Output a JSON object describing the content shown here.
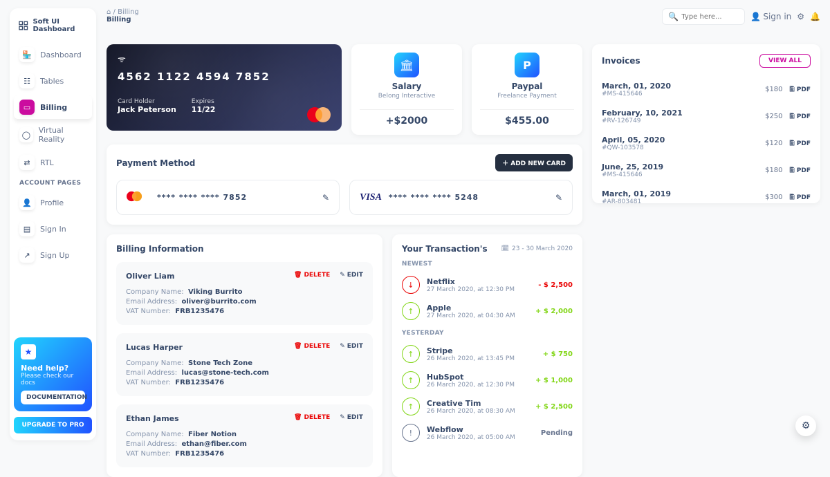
{
  "brand": "Soft UI Dashboard",
  "breadcrumb": {
    "root_icon": "home",
    "current": "Billing",
    "title": "Billing"
  },
  "search": {
    "placeholder": "Type here..."
  },
  "topnav": {
    "signin": "Sign in"
  },
  "sidebar": {
    "items": [
      {
        "icon": "store",
        "label": "Dashboard"
      },
      {
        "icon": "table",
        "label": "Tables"
      },
      {
        "icon": "card",
        "label": "Billing"
      },
      {
        "icon": "vr",
        "label": "Virtual Reality"
      },
      {
        "icon": "rtl",
        "label": "RTL"
      }
    ],
    "account_heading": "ACCOUNT PAGES",
    "account": [
      {
        "icon": "user",
        "label": "Profile"
      },
      {
        "icon": "doc",
        "label": "Sign In"
      },
      {
        "icon": "rocket",
        "label": "Sign Up"
      }
    ],
    "help": {
      "title": "Need help?",
      "sub": "Please check our docs",
      "btn": "DOCUMENTATION"
    },
    "upgrade": "UPGRADE TO PRO"
  },
  "credit_card": {
    "number": "4562   1122   4594   7852",
    "holder_label": "Card Holder",
    "holder": "Jack Peterson",
    "expires_label": "Expires",
    "expires": "11/22"
  },
  "mini": [
    {
      "icon": "bank",
      "title": "Salary",
      "sub": "Belong Interactive",
      "amount": "+$2000"
    },
    {
      "icon": "paypal",
      "title": "Paypal",
      "sub": "Freelance Payment",
      "amount": "$455.00"
    }
  ],
  "payment_method": {
    "title": "Payment Method",
    "add": "ADD NEW CARD",
    "cards": [
      {
        "brand": "mastercard",
        "masked": "****   ****   ****   7852"
      },
      {
        "brand": "visa",
        "masked": "****   ****   ****   5248"
      }
    ]
  },
  "invoices": {
    "title": "Invoices",
    "viewall": "VIEW ALL",
    "pdf": "PDF",
    "list": [
      {
        "date": "March, 01, 2020",
        "id": "#MS-415646",
        "amount": "$180"
      },
      {
        "date": "February, 10, 2021",
        "id": "#RV-126749",
        "amount": "$250"
      },
      {
        "date": "April, 05, 2020",
        "id": "#QW-103578",
        "amount": "$120"
      },
      {
        "date": "June, 25, 2019",
        "id": "#MS-415646",
        "amount": "$180"
      },
      {
        "date": "March, 01, 2019",
        "id": "#AR-803481",
        "amount": "$300"
      }
    ]
  },
  "billing_info": {
    "title": "Billing Information",
    "delete": "DELETE",
    "edit": "EDIT",
    "company_lbl": "Company Name:",
    "email_lbl": "Email Address:",
    "vat_lbl": "VAT Number:",
    "list": [
      {
        "name": "Oliver Liam",
        "company": "Viking Burrito",
        "email": "oliver@burrito.com",
        "vat": "FRB1235476"
      },
      {
        "name": "Lucas Harper",
        "company": "Stone Tech Zone",
        "email": "lucas@stone-tech.com",
        "vat": "FRB1235476"
      },
      {
        "name": "Ethan James",
        "company": "Fiber Notion",
        "email": "ethan@fiber.com",
        "vat": "FRB1235476"
      }
    ]
  },
  "transactions": {
    "title": "Your Transaction's",
    "range": "23 - 30 March 2020",
    "sec_newest": "NEWEST",
    "sec_yesterday": "YESTERDAY",
    "newest": [
      {
        "dir": "down",
        "name": "Netflix",
        "when": "27 March 2020, at 12:30 PM",
        "amount": "- $ 2,500",
        "cls": "neg"
      },
      {
        "dir": "up",
        "name": "Apple",
        "when": "27 March 2020, at 04:30 AM",
        "amount": "+ $ 2,000",
        "cls": "pos"
      }
    ],
    "yesterday": [
      {
        "dir": "up",
        "name": "Stripe",
        "when": "26 March 2020, at 13:45 PM",
        "amount": "+ $ 750",
        "cls": "pos"
      },
      {
        "dir": "up",
        "name": "HubSpot",
        "when": "26 March 2020, at 12:30 PM",
        "amount": "+ $ 1,000",
        "cls": "pos"
      },
      {
        "dir": "up",
        "name": "Creative Tim",
        "when": "26 March 2020, at 08:30 AM",
        "amount": "+ $ 2,500",
        "cls": "pos"
      },
      {
        "dir": "pending",
        "name": "Webflow",
        "when": "26 March 2020, at 05:00 AM",
        "amount": "Pending",
        "cls": "pend"
      }
    ]
  }
}
